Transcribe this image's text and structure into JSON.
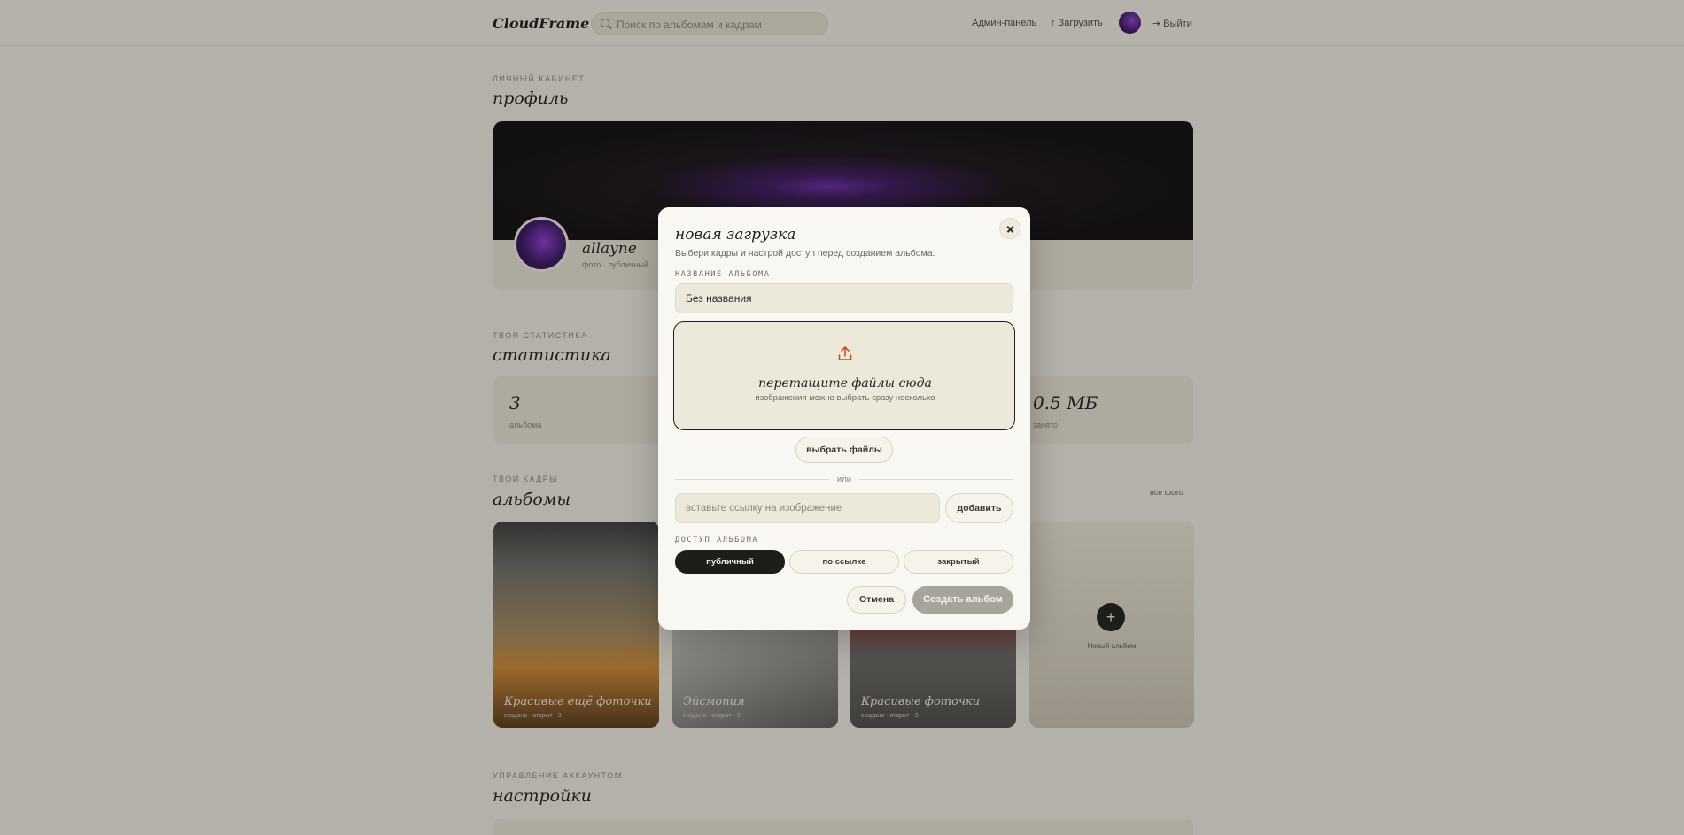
{
  "topbar": {
    "logo": "CloudFrame",
    "search_placeholder": "Поиск по альбомам и кадрам",
    "admin_link": "Админ-панель",
    "upload_link": "↑ Загрузить",
    "logout_link": "⇥ Выйти"
  },
  "profile": {
    "kicker": "Личный кабинет",
    "title": "профиль",
    "username": "allayne",
    "subtitle": "фото · публичный"
  },
  "stats": {
    "kicker": "твоя статистика",
    "title": "статистика",
    "items": [
      {
        "value": "3",
        "label": "альбома"
      },
      {
        "value": "0.5 МБ",
        "label": "занято"
      }
    ]
  },
  "albums": {
    "kicker": "твои кадры",
    "title": "альбомы",
    "all_link": "все фото",
    "items": [
      {
        "title": "Красивые ещё фоточки",
        "meta": "создано · открыт · 3"
      },
      {
        "title": "Эйсмопия",
        "meta": "создано · открыт · 3"
      },
      {
        "title": "Красивые фоточки",
        "meta": "создано · открыт · 3"
      }
    ],
    "new_album_label": "Новый альбом"
  },
  "settings": {
    "kicker": "управление аккаунтом",
    "title": "настройки"
  },
  "modal": {
    "title": "новая загрузка",
    "subtitle": "Выбери кадры и настрой доступ перед созданием альбома.",
    "name_label": "НАЗВАНИЕ АЛЬБОМА",
    "name_value": "Без названия",
    "dropzone_title": "перетащите файлы сюда",
    "dropzone_sub": "изображения можно выбрать сразу несколько",
    "choose_files": "выбрать файлы",
    "or_text": "или",
    "url_placeholder": "вставьте ссылку на изображение",
    "add_button": "добавить",
    "access_label": "ДОСТУП АЛЬБОМА",
    "access_options": [
      "публичный",
      "по ссылке",
      "закрытый"
    ],
    "access_selected": "публичный",
    "cancel_button": "Отмена",
    "create_button": "Создать альбом"
  },
  "icons": {
    "close": "close-icon",
    "upload": "upload-icon",
    "search": "search-icon"
  },
  "colors": {
    "background": "#f4f1e8",
    "accent_upload": "#c8501e",
    "dark": "#1e1d1a",
    "create_disabled": "#a7a49c"
  }
}
